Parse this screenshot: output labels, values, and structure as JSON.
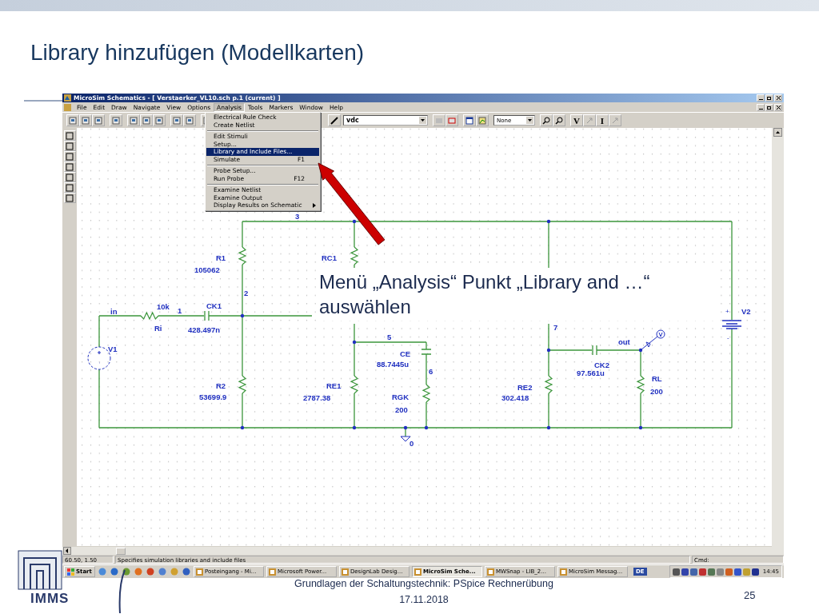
{
  "slide": {
    "title": "Library hinzufügen (Modellkarten)",
    "logo": "IMMS",
    "footer": "Grundlagen der Schaltungstechnik: PSpice Rechnerübung",
    "date": "17.11.2018",
    "page": "25"
  },
  "window": {
    "title": "MicroSim Schematics - [ Verstaerker_VL10.sch p.1 (current) ]",
    "menu": [
      {
        "label": "File",
        "selected": false
      },
      {
        "label": "Edit",
        "selected": false
      },
      {
        "label": "Draw",
        "selected": false
      },
      {
        "label": "Navigate",
        "selected": false
      },
      {
        "label": "View",
        "selected": false
      },
      {
        "label": "Options",
        "selected": false
      },
      {
        "label": "Analysis",
        "selected": true
      },
      {
        "label": "Tools",
        "selected": false
      },
      {
        "label": "Markers",
        "selected": false
      },
      {
        "label": "Window",
        "selected": false
      },
      {
        "label": "Help",
        "selected": false
      }
    ],
    "toolbar": {
      "part_field": "vdc",
      "display_field": "None",
      "letter_buttons": [
        "V",
        "I"
      ]
    }
  },
  "analysis_menu": [
    [
      {
        "label": "Electrical Rule Check",
        "selected": false,
        "submenu": false
      },
      {
        "label": "Create Netlist",
        "selected": false,
        "submenu": false
      }
    ],
    [
      {
        "label": "Edit Stimuli",
        "selected": false,
        "submenu": false
      },
      {
        "label": "Setup...",
        "selected": false,
        "submenu": false
      },
      {
        "label": "Library and Include Files...",
        "selected": true,
        "submenu": false
      },
      {
        "label": "Simulate",
        "shortcut": "F1",
        "selected": false,
        "submenu": false
      }
    ],
    [
      {
        "label": "Probe Setup...",
        "selected": false,
        "submenu": false
      },
      {
        "label": "Run Probe",
        "shortcut": "F12",
        "selected": false,
        "submenu": false
      }
    ],
    [
      {
        "label": "Examine Netlist",
        "selected": false,
        "submenu": false
      },
      {
        "label": "Examine Output",
        "selected": false,
        "submenu": false
      },
      {
        "label": "Display Results on Schematic",
        "selected": false,
        "submenu": true
      }
    ]
  ],
  "schematic": {
    "parts": [
      {
        "kind": "resistor",
        "name": "R1",
        "value": "105062"
      },
      {
        "kind": "resistor",
        "name": "RC1"
      },
      {
        "kind": "resistor",
        "name": "Ri",
        "value": "10k"
      },
      {
        "kind": "capacitor",
        "name": "CK1",
        "value": "428.497n"
      },
      {
        "kind": "battery",
        "name": "V2",
        "plus": "+",
        "minus": "-"
      },
      {
        "kind": "source",
        "name": "V1"
      },
      {
        "kind": "capacitor",
        "name": "CE",
        "value": "88.7445u"
      },
      {
        "kind": "capacitor",
        "name": "CK2",
        "value": "97.561u"
      },
      {
        "kind": "resistor",
        "name": "R2",
        "value": "53699.9"
      },
      {
        "kind": "resistor",
        "name": "RE1",
        "value": "2787.38"
      },
      {
        "kind": "resistor",
        "name": "RE2",
        "value": "302.418"
      },
      {
        "kind": "resistor",
        "name": "RL",
        "value": "200"
      },
      {
        "kind": "resistor",
        "name": "RGK",
        "value": "200"
      }
    ],
    "nets": [
      "3",
      "2",
      "1",
      "5",
      "6",
      "7",
      "in",
      "out",
      "0"
    ]
  },
  "callout": "Menü „Analysis“ Punkt „Library and …“ auswählen",
  "status_bar": {
    "coordinates": "60.50, 1.50",
    "message": "Specifies simulation libraries and include files",
    "command": "Cmd:"
  },
  "taskbar": {
    "start": "Start",
    "tasks": [
      {
        "label": "Posteingang - Mi...",
        "selected": false
      },
      {
        "label": "Microsoft Power...",
        "selected": false
      },
      {
        "label": "DesignLab Desig...",
        "selected": false
      },
      {
        "label": "MicroSim Sche...",
        "selected": true
      },
      {
        "label": "MWSnap - LIB_2...",
        "selected": false
      },
      {
        "label": "MicroSim Messag...",
        "selected": false
      }
    ],
    "language": "DE",
    "clock": "14:45"
  }
}
